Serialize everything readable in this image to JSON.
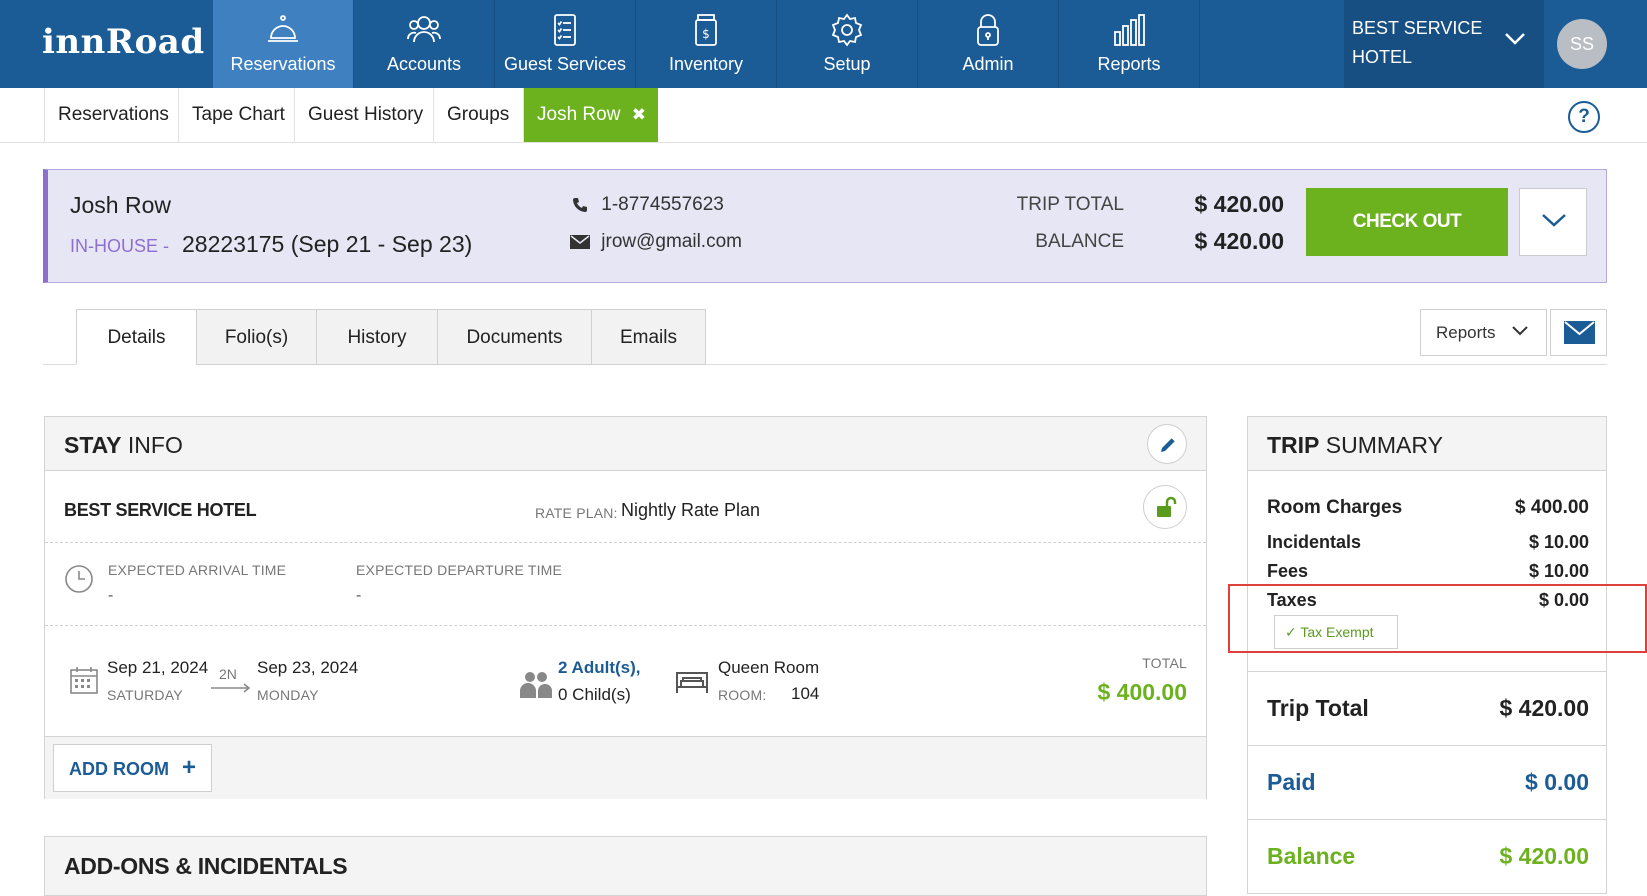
{
  "topnav": {
    "logo": "innRoad",
    "items": [
      {
        "label": "Reservations",
        "icon": "bell-icon"
      },
      {
        "label": "Accounts",
        "icon": "users-icon"
      },
      {
        "label": "Guest Services",
        "icon": "checklist-icon"
      },
      {
        "label": "Inventory",
        "icon": "inventory-jar-icon"
      },
      {
        "label": "Setup",
        "icon": "gear-icon"
      },
      {
        "label": "Admin",
        "icon": "lock-icon"
      },
      {
        "label": "Reports",
        "icon": "bar-chart-icon"
      }
    ],
    "hotel_line1": "BEST SERVICE",
    "hotel_line2": "HOTEL",
    "avatar": "SS"
  },
  "subnav": {
    "tabs": [
      "Reservations",
      "Tape Chart",
      "Guest History",
      "Groups"
    ],
    "active_tab": "Josh Row",
    "active_close": "✖",
    "help": "?"
  },
  "guest": {
    "name": "Josh Row",
    "status": "IN-HOUSE -",
    "confirmation": "28223175 (Sep 21 - Sep 23)",
    "phone": "1-8774557623",
    "email": "jrow@gmail.com",
    "trip_total_label": "TRIP TOTAL",
    "trip_total_value": "$ 420.00",
    "balance_label": "BALANCE",
    "balance_value": "$ 420.00",
    "checkout_label": "CHECK OUT"
  },
  "tabs": [
    "Details",
    "Folio(s)",
    "History",
    "Documents",
    "Emails"
  ],
  "reports_button": "Reports",
  "stay_info": {
    "title_bold": "STAY",
    "title_rest": " INFO",
    "hotel": "BEST SERVICE HOTEL",
    "rate_plan_label": "RATE PLAN:",
    "rate_plan_value": "Nightly Rate Plan",
    "arrival_label": "EXPECTED ARRIVAL TIME",
    "arrival_value": "-",
    "departure_label": "EXPECTED DEPARTURE TIME",
    "departure_value": "-",
    "checkin_date": "Sep 21, 2024",
    "checkin_day": "SATURDAY",
    "nights": "2N",
    "checkout_date": "Sep 23, 2024",
    "checkout_day": "MONDAY",
    "adults": "2 Adult(s),",
    "children": "0 Child(s)",
    "room_type": "Queen Room",
    "room_label": "ROOM:",
    "room_number": "104",
    "total_label": "TOTAL",
    "total_value": "$ 400.00",
    "add_room": "ADD ROOM"
  },
  "addons": {
    "title": "ADD-ONS & INCIDENTALS"
  },
  "trip_summary": {
    "title_bold": "TRIP",
    "title_rest": " SUMMARY",
    "room_charges_label": "Room Charges",
    "room_charges_value": "$ 400.00",
    "incidentals_label": "Incidentals",
    "incidentals_value": "$ 10.00",
    "fees_label": "Fees",
    "fees_value": "$ 10.00",
    "taxes_label": "Taxes",
    "taxes_value": "$ 0.00",
    "tax_exempt": "Tax Exempt",
    "trip_total_label": "Trip Total",
    "trip_total_value": "$ 420.00",
    "paid_label": "Paid",
    "paid_value": "$ 0.00",
    "balance_label": "Balance",
    "balance_value": "$ 420.00"
  },
  "colors": {
    "nav": "#1c5c96",
    "nav_active": "#3e80c0",
    "green": "#6cb21f",
    "purple": "#8d6fd0",
    "link_blue": "#1c5c96",
    "highlight": "#e0403c"
  }
}
